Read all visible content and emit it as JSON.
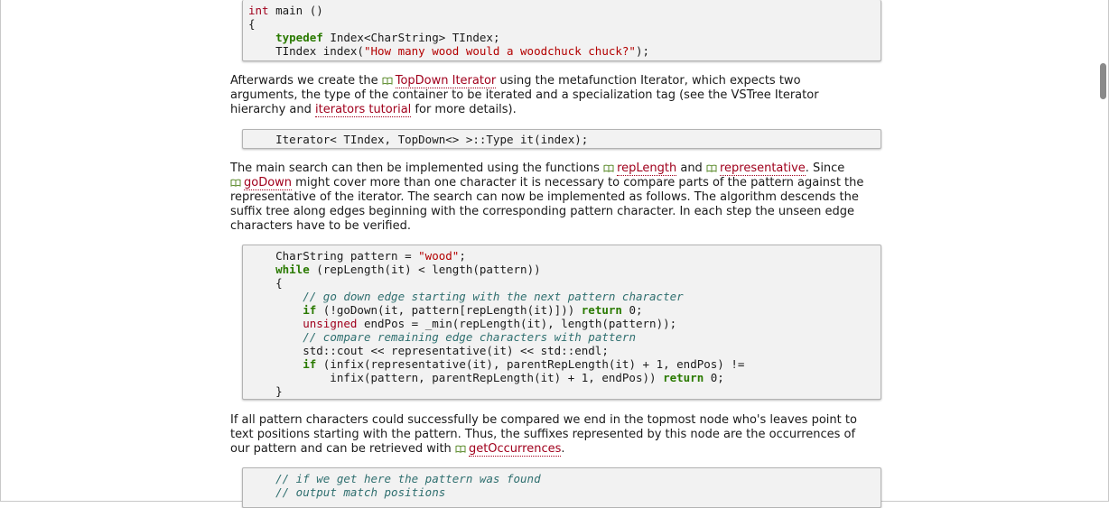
{
  "code_blocks": [
    {
      "lines": [
        [
          {
            "t": "int",
            "c": "ty"
          },
          {
            "t": " main ()",
            "c": "nm"
          }
        ],
        [
          {
            "t": "{",
            "c": "nm"
          }
        ],
        [
          {
            "t": "    ",
            "c": "nm"
          },
          {
            "t": "typedef",
            "c": "kw"
          },
          {
            "t": " Index<CharString> TIndex;",
            "c": "nm"
          }
        ],
        [
          {
            "t": "    TIndex index(",
            "c": "nm"
          },
          {
            "t": "\"How many wood would a woodchuck chuck?\"",
            "c": "st"
          },
          {
            "t": ");",
            "c": "nm"
          }
        ]
      ]
    },
    {
      "lines": [
        [
          {
            "t": "    Iterator< TIndex, TopDown<> >::Type it(index);",
            "c": "nm"
          }
        ]
      ]
    },
    {
      "lines": [
        [
          {
            "t": "    CharString pattern = ",
            "c": "nm"
          },
          {
            "t": "\"wood\"",
            "c": "st"
          },
          {
            "t": ";",
            "c": "nm"
          }
        ],
        [
          {
            "t": "    ",
            "c": "nm"
          },
          {
            "t": "while",
            "c": "kw"
          },
          {
            "t": " (repLength(it) < length(pattern))",
            "c": "nm"
          }
        ],
        [
          {
            "t": "    {",
            "c": "nm"
          }
        ],
        [
          {
            "t": "        ",
            "c": "nm"
          },
          {
            "t": "// go down edge starting with the next pattern character",
            "c": "cm"
          }
        ],
        [
          {
            "t": "        ",
            "c": "nm"
          },
          {
            "t": "if",
            "c": "kw"
          },
          {
            "t": " (!goDown(it, pattern[repLength(it)])) ",
            "c": "nm"
          },
          {
            "t": "return",
            "c": "kw"
          },
          {
            "t": " 0;",
            "c": "nm"
          }
        ],
        [
          {
            "t": "        ",
            "c": "nm"
          },
          {
            "t": "unsigned",
            "c": "ty"
          },
          {
            "t": " endPos = _min(repLength(it), length(pattern));",
            "c": "nm"
          }
        ],
        [
          {
            "t": "        ",
            "c": "nm"
          },
          {
            "t": "// compare remaining edge characters with pattern",
            "c": "cm"
          }
        ],
        [
          {
            "t": "        std::cout << representative(it) << std::endl;",
            "c": "nm"
          }
        ],
        [
          {
            "t": "        ",
            "c": "nm"
          },
          {
            "t": "if",
            "c": "kw"
          },
          {
            "t": " (infix(representative(it), parentRepLength(it) + 1, endPos) !=",
            "c": "nm"
          }
        ],
        [
          {
            "t": "            infix(pattern, parentRepLength(it) + 1, endPos)) ",
            "c": "nm"
          },
          {
            "t": "return",
            "c": "kw"
          },
          {
            "t": " 0;",
            "c": "nm"
          }
        ],
        [
          {
            "t": "    }",
            "c": "nm"
          }
        ]
      ]
    },
    {
      "lines": [
        [
          {
            "t": "    ",
            "c": "nm"
          },
          {
            "t": "// if we get here the pattern was found",
            "c": "cm"
          }
        ],
        [
          {
            "t": "    ",
            "c": "nm"
          },
          {
            "t": "// output match positions",
            "c": "cm"
          }
        ]
      ]
    }
  ],
  "paragraphs": [
    {
      "lines": [
        [
          {
            "t": "Afterwards we create the "
          },
          {
            "link": "TopDown Iterator",
            "book": true
          },
          {
            "t": " using the metafunction Iterator, which expects two"
          }
        ],
        [
          {
            "t": "arguments, the type of the container to be iterated and a specialization tag (see the VSTree Iterator"
          }
        ],
        [
          {
            "t": "hierarchy and "
          },
          {
            "link": "iterators tutorial"
          },
          {
            "t": " for more details)."
          }
        ]
      ]
    },
    {
      "lines": [
        [
          {
            "t": "The main search can then be implemented using the functions "
          },
          {
            "link": "repLength",
            "book": true
          },
          {
            "t": " and "
          },
          {
            "link": "representative",
            "book": true
          },
          {
            "t": ". Since"
          }
        ],
        [
          {
            "link": "goDown",
            "book": true
          },
          {
            "t": " might cover more than one character it is necessary to compare parts of the pattern against the"
          }
        ],
        [
          {
            "t": "representative of the iterator. The search can now be implemented as follows. The algorithm descends the"
          }
        ],
        [
          {
            "t": "suffix tree along edges beginning with the corresponding pattern character. In each step the unseen edge"
          }
        ],
        [
          {
            "t": "characters have to be verified."
          }
        ]
      ]
    },
    {
      "lines": [
        [
          {
            "t": "If all pattern characters could successfully be compared we end in the topmost node who's leaves point to"
          }
        ],
        [
          {
            "t": "text positions starting with the pattern. Thus, the suffixes represented by this node are the occurrences of"
          }
        ],
        [
          {
            "t": "our pattern and can be retrieved with "
          },
          {
            "link": "getOccurrences",
            "book": true
          },
          {
            "t": "."
          }
        ]
      ]
    }
  ]
}
